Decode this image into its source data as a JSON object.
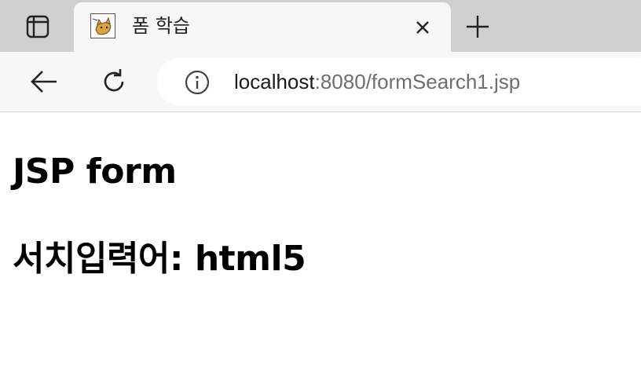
{
  "tab": {
    "title": "폼 학습"
  },
  "address_bar": {
    "host": "localhost",
    "rest": ":8080/formSearch1.jsp"
  },
  "page": {
    "heading": "JSP form",
    "search_label": "서치입력어: html5"
  },
  "icons": {
    "tab_actions": "tab-actions-icon",
    "favicon": "tomcat-favicon",
    "close": "close-icon",
    "new_tab": "plus-icon",
    "back": "back-arrow-icon",
    "reload": "reload-icon",
    "info": "info-icon"
  },
  "colors": {
    "tabstrip_bg": "#cfcfcf",
    "toolbar_bg": "#f7f7f7",
    "url_host": "#1a1a1a",
    "url_rest": "#6e6e6e"
  }
}
